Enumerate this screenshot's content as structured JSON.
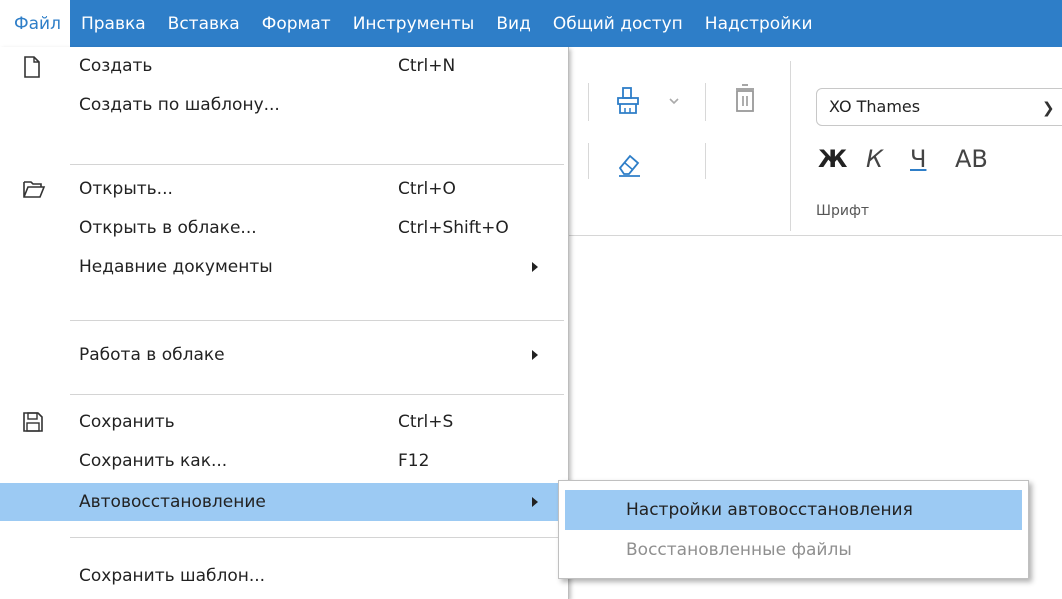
{
  "menubar": {
    "items": [
      "Файл",
      "Правка",
      "Вставка",
      "Формат",
      "Инструменты",
      "Вид",
      "Общий доступ",
      "Надстройки"
    ]
  },
  "toolbar": {
    "font_name": "XO Thames",
    "bold": "Ж",
    "italic": "К",
    "underline": "Ч",
    "caps": "AB",
    "font_group_label": "Шрифт",
    "icons": [
      "paint-format-icon",
      "dropdown-chevron-icon",
      "trash-icon",
      "eraser-icon"
    ]
  },
  "file_menu": {
    "items": [
      {
        "label": "Создать",
        "shortcut": "Ctrl+N",
        "icon": "new-document-icon"
      },
      {
        "label": "Создать по шаблону...",
        "shortcut": ""
      },
      {
        "label": "Открыть...",
        "shortcut": "Ctrl+O",
        "icon": "open-folder-icon"
      },
      {
        "label": "Открыть в облаке...",
        "shortcut": "Ctrl+Shift+O"
      },
      {
        "label": "Недавние документы",
        "shortcut": "",
        "submenu": true
      },
      {
        "label": "Работа в облаке",
        "shortcut": "",
        "submenu": true
      },
      {
        "label": "Сохранить",
        "shortcut": "Ctrl+S",
        "icon": "save-icon"
      },
      {
        "label": "Сохранить как...",
        "shortcut": "F12"
      },
      {
        "label": "Автовосстановление",
        "shortcut": "",
        "submenu": true,
        "highlighted": true
      },
      {
        "label": "Сохранить шаблон...",
        "shortcut": ""
      }
    ]
  },
  "autorecovery_submenu": {
    "items": [
      {
        "label": "Настройки автовосстановления",
        "highlighted": true,
        "enabled": true
      },
      {
        "label": "Восстановленные файлы",
        "highlighted": false,
        "enabled": false
      }
    ]
  },
  "colors": {
    "menubar_bg": "#2e7ec8",
    "highlight": "#9ccaf3",
    "disabled_text": "#8f8f8f"
  }
}
